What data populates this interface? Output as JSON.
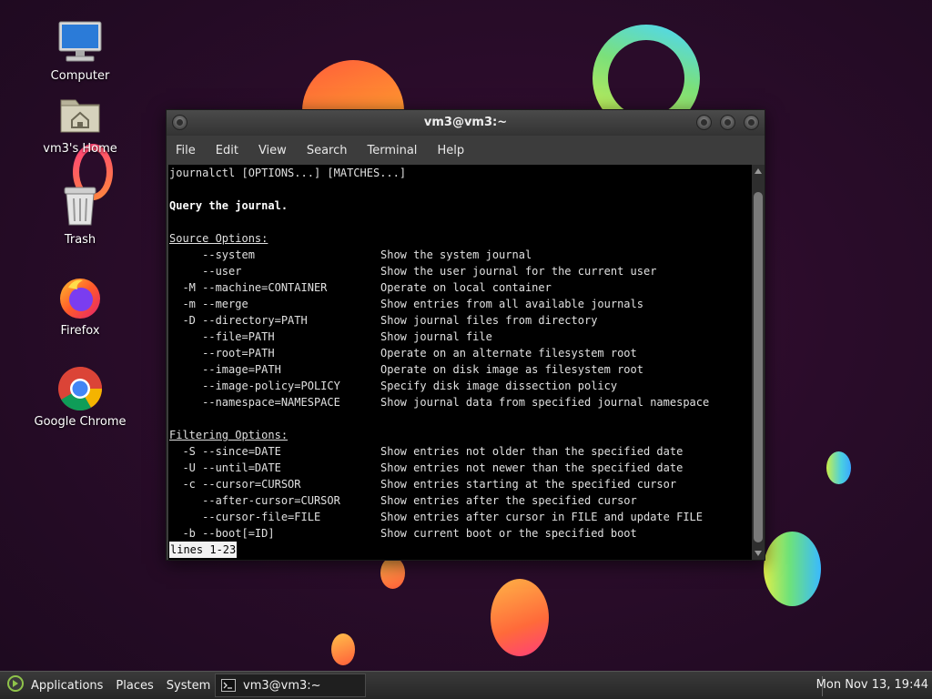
{
  "desktop": {
    "icons": [
      {
        "label": "Computer"
      },
      {
        "label": "vm3's Home"
      },
      {
        "label": "Trash"
      },
      {
        "label": "Firefox"
      },
      {
        "label": "Google Chrome"
      }
    ]
  },
  "window": {
    "title": "vm3@vm3:~",
    "menu": [
      "File",
      "Edit",
      "View",
      "Search",
      "Terminal",
      "Help"
    ]
  },
  "terminal": {
    "usage": "journalctl [OPTIONS...] [MATCHES...]",
    "description": "Query the journal.",
    "source_heading": "Source Options:",
    "source_options": [
      {
        "flag": "     --system",
        "desc": "Show the system journal"
      },
      {
        "flag": "     --user",
        "desc": "Show the user journal for the current user"
      },
      {
        "flag": "  -M --machine=CONTAINER",
        "desc": "Operate on local container"
      },
      {
        "flag": "  -m --merge",
        "desc": "Show entries from all available journals"
      },
      {
        "flag": "  -D --directory=PATH",
        "desc": "Show journal files from directory"
      },
      {
        "flag": "     --file=PATH",
        "desc": "Show journal file"
      },
      {
        "flag": "     --root=PATH",
        "desc": "Operate on an alternate filesystem root"
      },
      {
        "flag": "     --image=PATH",
        "desc": "Operate on disk image as filesystem root"
      },
      {
        "flag": "     --image-policy=POLICY",
        "desc": "Specify disk image dissection policy"
      },
      {
        "flag": "     --namespace=NAMESPACE",
        "desc": "Show journal data from specified journal namespace"
      }
    ],
    "filter_heading": "Filtering Options:",
    "filter_options": [
      {
        "flag": "  -S --since=DATE",
        "desc": "Show entries not older than the specified date"
      },
      {
        "flag": "  -U --until=DATE",
        "desc": "Show entries not newer than the specified date"
      },
      {
        "flag": "  -c --cursor=CURSOR",
        "desc": "Show entries starting at the specified cursor"
      },
      {
        "flag": "     --after-cursor=CURSOR",
        "desc": "Show entries after the specified cursor"
      },
      {
        "flag": "     --cursor-file=FILE",
        "desc": "Show entries after cursor in FILE and update FILE"
      },
      {
        "flag": "  -b --boot[=ID]",
        "desc": "Show current boot or the specified boot"
      }
    ],
    "status": "lines 1-23"
  },
  "taskbar": {
    "applications": "Applications",
    "places": "Places",
    "system": "System",
    "task_label": "vm3@vm3:~",
    "clock": "Mon Nov 13, 19:44"
  }
}
